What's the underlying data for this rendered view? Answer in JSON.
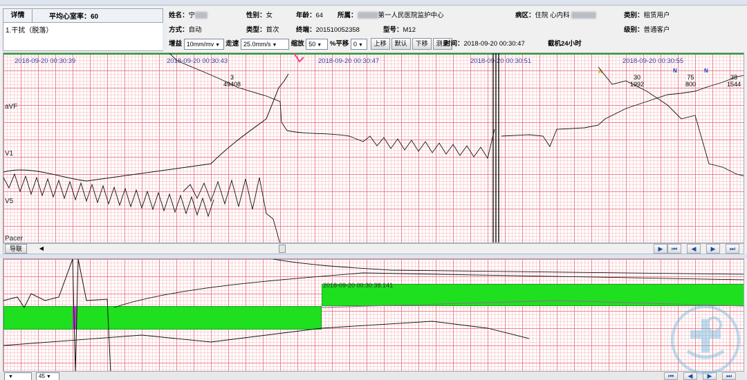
{
  "detail": {
    "tab_label": "详情",
    "avg_hr_label": "平均心室率：60",
    "text": "1.干扰（脱落）"
  },
  "patient": {
    "name_label": "姓名：",
    "name_value": "宁",
    "gender_label": "性别：",
    "gender_value": "女",
    "age_label": "年龄：",
    "age_value": "64",
    "hospital_label": "所属：",
    "hospital_value": "第一人民医院监护中心",
    "ward_label": "病区：",
    "ward_value": "住院 心内科",
    "category_label": "类别：",
    "category_value": "租赁用户",
    "method_label": "方式：",
    "method_value": "自动",
    "type_label": "类型：",
    "type_value": "首次",
    "terminal_label": "终端：",
    "terminal_value": "201510052358",
    "model_label": "型号：",
    "model_value": "M12",
    "level_label": "级别：",
    "level_value": "普通客户"
  },
  "toolbar": {
    "gain_label": "增益",
    "gain_value": "10mm/mv",
    "speed_label": "走速",
    "speed_value": "25.0mm/s",
    "zoom_label": "缩放",
    "zoom_value": "50",
    "pan_label": "%平移",
    "pan_value": "0",
    "move_up": "上移",
    "default": "默认",
    "move_down": "下移",
    "measure": "测量",
    "time_label": "时间：",
    "time_value": "2018-09-20 00:30:47",
    "holter_label": "截机24小时"
  },
  "main_ecg": {
    "timestamps": [
      "2018-09-20 00:30:39",
      "2018-09-20 00:30:43",
      "2018-09-20 00:30:47",
      "2018-09-20 00:30:51",
      "2018-09-20 00:30:55"
    ],
    "leads": [
      "aVF",
      "V1",
      "V5",
      "Pacer"
    ],
    "beats": [
      {
        "top": "3",
        "bottom": "49408"
      },
      {
        "top": "30",
        "bottom": "1992"
      },
      {
        "top": "75",
        "bottom": "800"
      },
      {
        "top": "38",
        "bottom": "1544"
      }
    ],
    "markers": [
      "A",
      "N",
      "N"
    ]
  },
  "nav": {
    "lead_button": "导联"
  },
  "sub_ecg": {
    "timestamp": "2018-09-20 00:30:38.141"
  },
  "bottom": {
    "zoom_value": "45"
  },
  "colors": {
    "grid_major": "#e66e78",
    "grid_minor": "#f5bec3",
    "event_bar": "#1fe01f",
    "timestamp": "#3a3aa0",
    "nav_icon": "#1a4aa8"
  }
}
